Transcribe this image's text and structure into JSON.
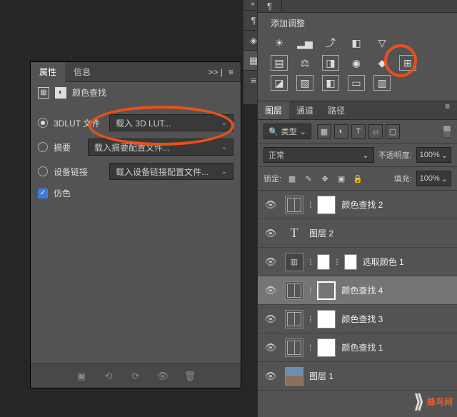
{
  "props": {
    "tab_properties": "属性",
    "tab_info": "信息",
    "collapse": ">> |",
    "title": "颜色查找",
    "rows": {
      "lut_label": "3DLUT 文件",
      "lut_value": "载入 3D LUT...",
      "abstract_label": "摘要",
      "abstract_value": "载入摘要配置文件...",
      "devlink_label": "设备链接",
      "devlink_value": "载入设备链接配置文件...",
      "dither_label": "仿色"
    }
  },
  "adjustments": {
    "title": "添加调整"
  },
  "layers": {
    "tab_layers": "图层",
    "tab_channels": "通道",
    "tab_paths": "路径",
    "filter_type": "类型",
    "blend_mode": "正常",
    "opacity_label": "不透明度:",
    "opacity_value": "100%",
    "lock_label": "锁定:",
    "fill_label": "填充:",
    "fill_value": "100%",
    "items": [
      {
        "name": "颜色查找 2",
        "type": "grid"
      },
      {
        "name": "图层 2",
        "type": "text"
      },
      {
        "name": "选取颜色 1",
        "type": "env"
      },
      {
        "name": "颜色查找 4",
        "type": "grid",
        "selected": true,
        "outline": true
      },
      {
        "name": "颜色查找 3",
        "type": "grid"
      },
      {
        "name": "颜色查找 1",
        "type": "grid"
      },
      {
        "name": "图层 1",
        "type": "img"
      }
    ]
  },
  "watermark": "蜂鸟网"
}
